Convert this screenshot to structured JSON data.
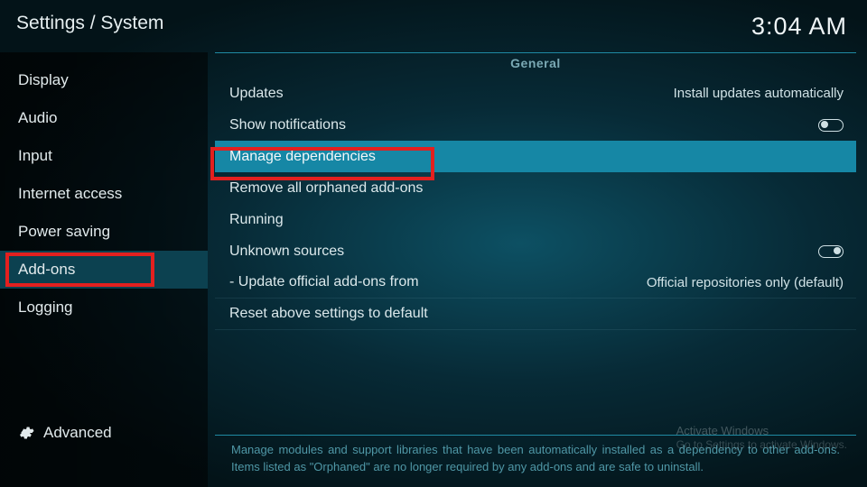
{
  "header": {
    "breadcrumb": "Settings / System",
    "clock": "3:04 AM"
  },
  "sidebar": {
    "items": [
      {
        "label": "Display"
      },
      {
        "label": "Audio"
      },
      {
        "label": "Input"
      },
      {
        "label": "Internet access"
      },
      {
        "label": "Power saving"
      },
      {
        "label": "Add-ons"
      },
      {
        "label": "Logging"
      }
    ],
    "selected": "Add-ons",
    "level_label": "Advanced"
  },
  "main": {
    "section": "General",
    "rows": {
      "updates_label": "Updates",
      "updates_value": "Install updates automatically",
      "show_notifications_label": "Show notifications",
      "show_notifications_on": false,
      "manage_dependencies_label": "Manage dependencies",
      "remove_orphaned_label": "Remove all orphaned add-ons",
      "running_label": "Running",
      "unknown_sources_label": "Unknown sources",
      "unknown_sources_on": true,
      "update_official_label": "- Update official add-ons from",
      "update_official_value": "Official repositories only (default)",
      "reset_label": "Reset above settings to default"
    },
    "help_text": "Manage modules and support libraries that have been automatically installed as a dependency to other add-ons. Items listed as \"Orphaned\" are no longer required by any add-ons and are safe to uninstall."
  },
  "watermark": {
    "title": "Activate Windows",
    "sub": "Go to Settings to activate Windows."
  }
}
